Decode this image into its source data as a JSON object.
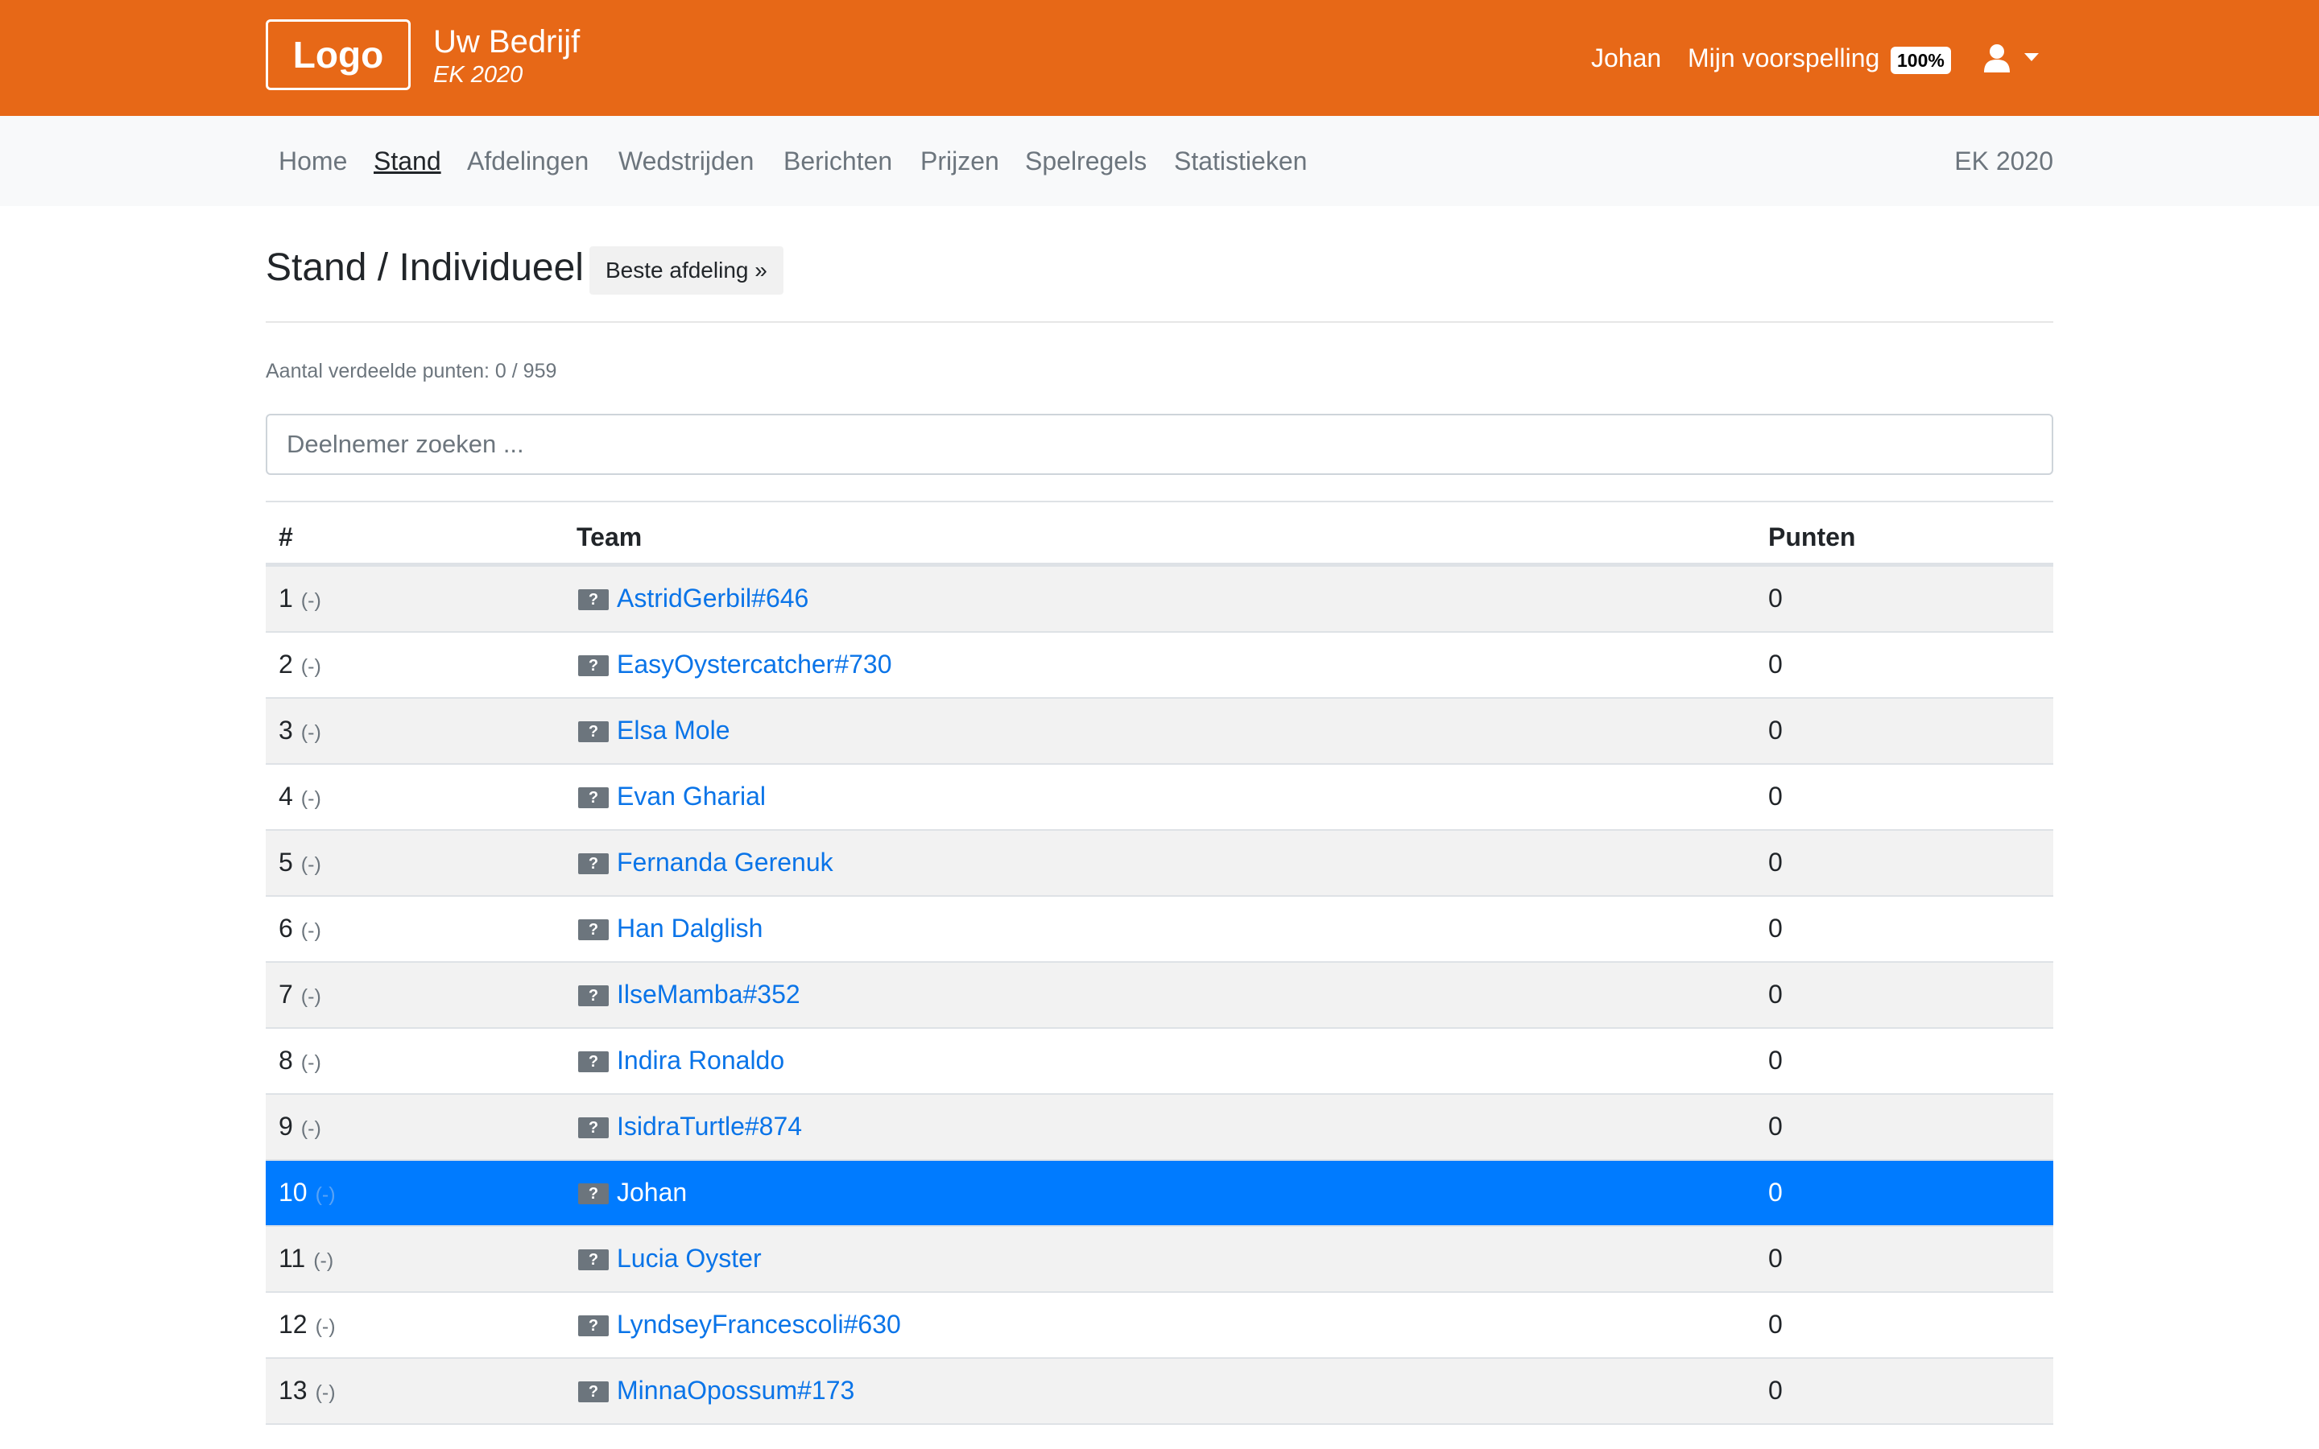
{
  "header": {
    "logo": "Logo",
    "company": "Uw Bedrijf",
    "tournament": "EK 2020",
    "user": "Johan",
    "my_prediction": "Mijn voorspelling",
    "progress": "100%",
    "user_icon": "user-icon"
  },
  "nav": {
    "items": [
      "Home",
      "Stand",
      "Afdelingen",
      "Wedstrijden",
      "Berichten",
      "Prijzen",
      "Spelregels",
      "Statistieken"
    ],
    "active": "Stand",
    "right": "EK 2020"
  },
  "page": {
    "title": "Stand / Individueel",
    "best_button": "Beste afdeling »",
    "points_info": "Aantal verdeelde punten: 0 / 959",
    "search_placeholder": "Deelnemer zoeken ..."
  },
  "table": {
    "headers": {
      "rank": "#",
      "team": "Team",
      "points": "Punten"
    },
    "rows": [
      {
        "rank": "1",
        "delta": "(-)",
        "icon": "?",
        "team": "AstridGerbil#646",
        "points": "0"
      },
      {
        "rank": "2",
        "delta": "(-)",
        "icon": "?",
        "team": "EasyOystercatcher#730",
        "points": "0"
      },
      {
        "rank": "3",
        "delta": "(-)",
        "icon": "?",
        "team": "Elsa Mole",
        "points": "0"
      },
      {
        "rank": "4",
        "delta": "(-)",
        "icon": "?",
        "team": "Evan Gharial",
        "points": "0"
      },
      {
        "rank": "5",
        "delta": "(-)",
        "icon": "?",
        "team": "Fernanda Gerenuk",
        "points": "0"
      },
      {
        "rank": "6",
        "delta": "(-)",
        "icon": "?",
        "team": "Han Dalglish",
        "points": "0"
      },
      {
        "rank": "7",
        "delta": "(-)",
        "icon": "?",
        "team": "IlseMamba#352",
        "points": "0"
      },
      {
        "rank": "8",
        "delta": "(-)",
        "icon": "?",
        "team": "Indira Ronaldo",
        "points": "0"
      },
      {
        "rank": "9",
        "delta": "(-)",
        "icon": "?",
        "team": "IsidraTurtle#874",
        "points": "0"
      },
      {
        "rank": "10",
        "delta": "(-)",
        "icon": "?",
        "team": "Johan",
        "points": "0",
        "highlighted": true
      },
      {
        "rank": "11",
        "delta": "(-)",
        "icon": "?",
        "team": "Lucia Oyster",
        "points": "0"
      },
      {
        "rank": "12",
        "delta": "(-)",
        "icon": "?",
        "team": "LyndseyFrancescoli#630",
        "points": "0"
      },
      {
        "rank": "13",
        "delta": "(-)",
        "icon": "?",
        "team": "MinnaOpossum#173",
        "points": "0"
      }
    ]
  },
  "colors": {
    "brand": "#e76817",
    "highlight": "#007bff",
    "link": "#0a74e8"
  }
}
